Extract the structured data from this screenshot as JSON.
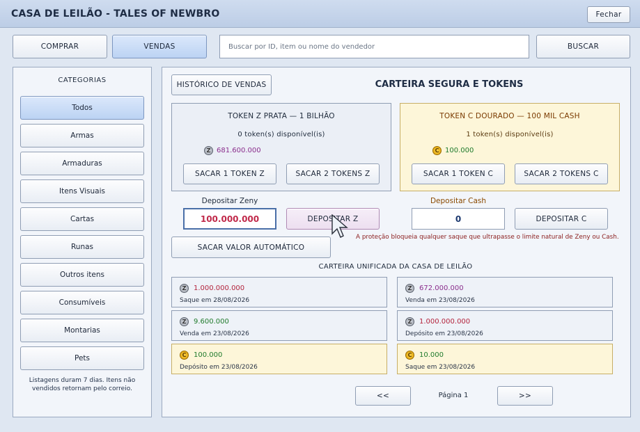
{
  "window": {
    "title": "CASA DE LEILÃO - TALES OF NEWBRO",
    "close_label": "Fechar"
  },
  "toolbar": {
    "buy_label": "COMPRAR",
    "sell_label": "VENDAS",
    "search_placeholder": "Buscar por ID, item ou nome do vendedor",
    "search_label": "BUSCAR"
  },
  "sidebar": {
    "title": "CATEGORIAS",
    "items": [
      {
        "label": "Todos",
        "active": true
      },
      {
        "label": "Armas"
      },
      {
        "label": "Armaduras"
      },
      {
        "label": "Itens Visuais"
      },
      {
        "label": "Cartas"
      },
      {
        "label": "Runas"
      },
      {
        "label": "Outros itens"
      },
      {
        "label": "Consumíveis"
      },
      {
        "label": "Montarias"
      },
      {
        "label": "Pets"
      }
    ],
    "note_line1": "Listagens duram 7 dias. Itens não",
    "note_line2": "vendidos retornam pelo correio."
  },
  "main": {
    "history_label": "HISTÓRICO DE VENDAS",
    "heading": "CARTEIRA SEGURA E TOKENS",
    "token_z": {
      "title": "TOKEN Z PRATA — 1 BILHÃO",
      "available": "0 token(s) disponível(is)",
      "balance": "681.600.000",
      "withdraw1": "SACAR 1 TOKEN Z",
      "withdraw2": "SACAR 2 TOKENS Z"
    },
    "token_c": {
      "title": "TOKEN C DOURADO — 100 MIL CASH",
      "available": "1 token(s) disponível(is)",
      "balance": "100.000",
      "withdraw1": "SACAR 1 TOKEN C",
      "withdraw2": "SACAR 2 TOKENS C"
    },
    "deposit_zeny_label": "Depositar Zeny",
    "deposit_zeny_value": "100.000.000",
    "deposit_z_button": "DEPOSITAR Z",
    "deposit_cash_label": "Depositar Cash",
    "deposit_cash_value": "0",
    "deposit_c_button": "DEPOSITAR C",
    "auto_withdraw": "SACAR VALOR AUTOMÁTICO",
    "protection_note": "A proteção bloqueia qualquer saque que ultrapasse o limite natural de Zeny ou Cash.",
    "wallet_title": "CARTEIRA UNIFICADA DA CASA DE LEILÃO",
    "entries": [
      {
        "coin": "Z",
        "amount": "1.000.000.000",
        "desc": "Saque em 28/08/2026",
        "color": "#b3233c"
      },
      {
        "coin": "Z",
        "amount": "672.000.000",
        "desc": "Venda em 23/08/2026",
        "color": "#8a2d8c"
      },
      {
        "coin": "Z",
        "amount": "9.600.000",
        "desc": "Venda em 23/08/2026",
        "color": "#1f7a2b"
      },
      {
        "coin": "Z",
        "amount": "1.000.000.000",
        "desc": "Depósito em 23/08/2026",
        "color": "#b3233c"
      },
      {
        "coin": "C",
        "amount": "100.000",
        "desc": "Depósito em 23/08/2026",
        "color": "#1f7a2b"
      },
      {
        "coin": "C",
        "amount": "10.000",
        "desc": "Saque em 23/08/2026",
        "color": "#1f7a2b"
      }
    ],
    "prev_label": "<<",
    "page_label": "Página 1",
    "next_label": ">>"
  },
  "icons": {
    "zeny": "zeny-coin-icon",
    "cash": "cash-coin-icon",
    "cursor": "mouse-cursor-icon"
  },
  "colors": {
    "accent": "#bcd3f3",
    "gold_card": "#fdf6d9",
    "error_text": "#8a1c1c"
  }
}
